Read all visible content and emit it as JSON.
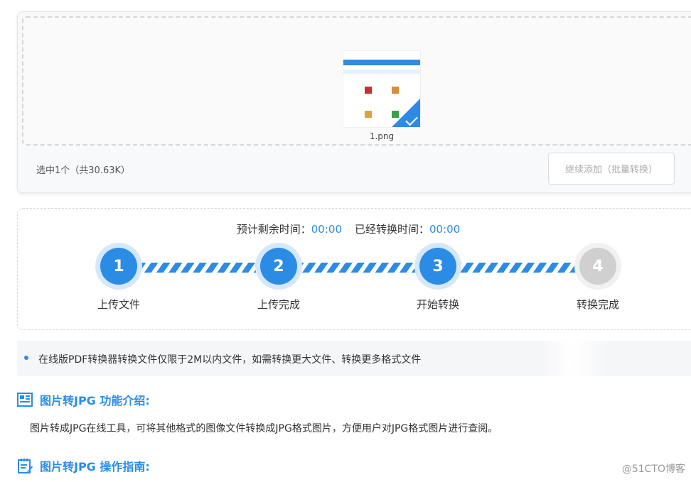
{
  "upload": {
    "file_name": "1.png",
    "selected_info": "选中1个（共30.63K）",
    "add_more_label": "继续添加（批量转换）"
  },
  "progress": {
    "remaining_label": "预计剩余时间：",
    "remaining_value": "00:00",
    "elapsed_label": "已经转换时间：",
    "elapsed_value": "00:00",
    "steps": [
      {
        "number": "1",
        "label": "上传文件",
        "state": "done"
      },
      {
        "number": "2",
        "label": "上传完成",
        "state": "done"
      },
      {
        "number": "3",
        "label": "开始转换",
        "state": "done"
      },
      {
        "number": "4",
        "label": "转换完成",
        "state": "pending"
      }
    ]
  },
  "notice": {
    "text": "在线版PDF转换器转换文件仅限于2M以内文件，如需转换更大文件、转换更多格式文件"
  },
  "intro": {
    "title": "图片转JPG 功能介绍:",
    "body": "图片转成JPG在线工具，可将其他格式的图像文件转换成JPG格式图片，方便用户对JPG格式图片进行查阅。"
  },
  "guide": {
    "title": "图片转JPG 操作指南:"
  },
  "watermark": "@51CTO博客",
  "colors": {
    "accent": "#2b8ce6",
    "inactive_step": "#d0d0d0"
  }
}
